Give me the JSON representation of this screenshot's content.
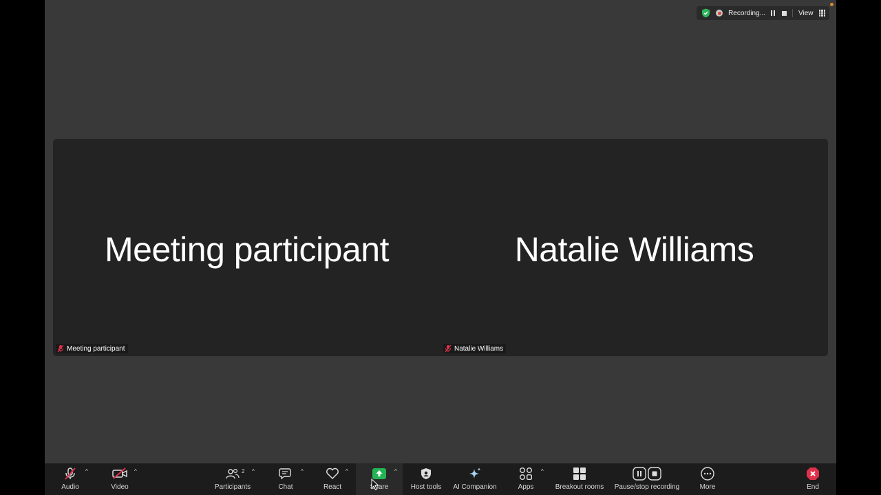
{
  "topbar": {
    "recording_label": "Recording...",
    "view_label": "View"
  },
  "tiles": [
    {
      "display_name": "Meeting participant",
      "name_tag": "Meeting participant"
    },
    {
      "display_name": "Natalie Williams",
      "name_tag": "Natalie Williams"
    }
  ],
  "toolbar": {
    "audio": "Audio",
    "video": "Video",
    "participants": "Participants",
    "participants_count": "2",
    "chat": "Chat",
    "react": "React",
    "share": "Share",
    "host_tools": "Host tools",
    "ai_companion": "AI Companion",
    "apps": "Apps",
    "breakout_rooms": "Breakout rooms",
    "pause_stop_recording": "Pause/stop recording",
    "more": "More",
    "end": "End"
  },
  "colors": {
    "share_green": "#23b455",
    "end_red": "#e0314b",
    "mute_red": "#e0314b"
  }
}
